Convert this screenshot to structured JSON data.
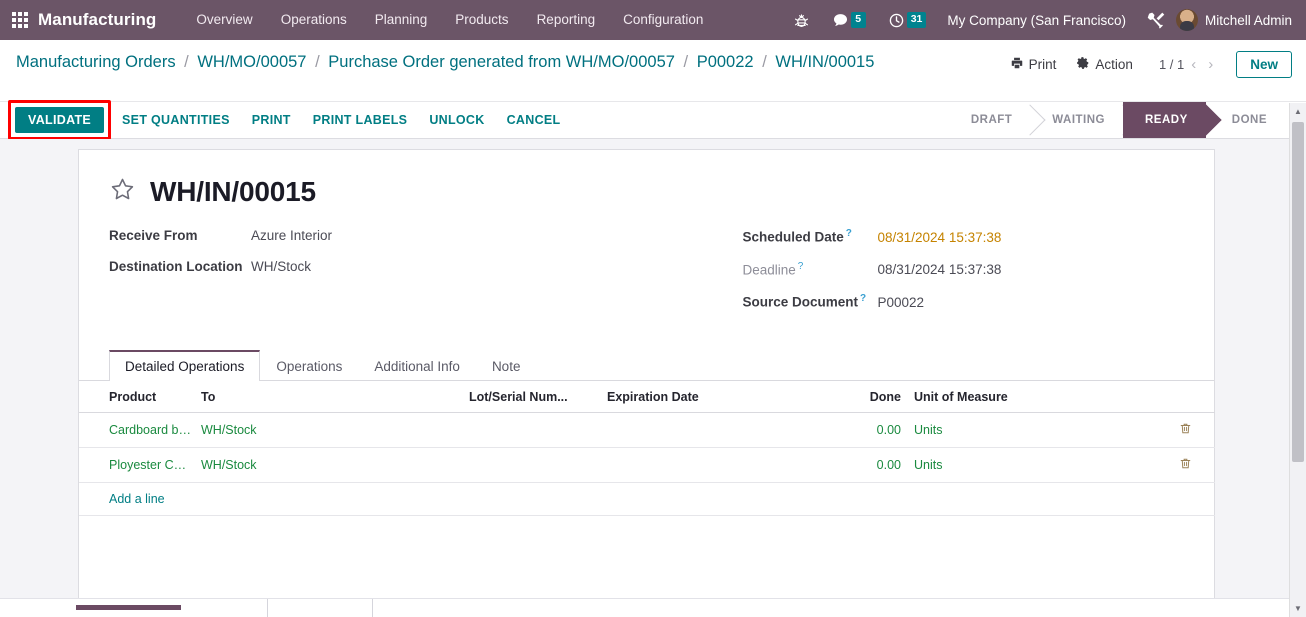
{
  "navbar": {
    "apps_icon": "apps-grid-icon",
    "brand": "Manufacturing",
    "menu": [
      {
        "label": "Overview"
      },
      {
        "label": "Operations"
      },
      {
        "label": "Planning"
      },
      {
        "label": "Products"
      },
      {
        "label": "Reporting"
      },
      {
        "label": "Configuration"
      }
    ],
    "bug_icon": "bug-icon",
    "messages_icon": "chat-bubble-icon",
    "messages_count": "5",
    "activities_icon": "clock-icon",
    "activities_count": "31",
    "company": "My Company (San Francisco)",
    "tools_icon": "wrench-screwdriver-icon",
    "user": "Mitchell Admin",
    "accent_color": "#6b5567",
    "badge_color": "#00838f"
  },
  "breadcrumb": {
    "items": [
      "Manufacturing Orders",
      "WH/MO/00057",
      "Purchase Order generated from WH/MO/00057",
      "P00022",
      "WH/IN/00015"
    ],
    "separator": "/",
    "link_color": "#00707f"
  },
  "control_panel": {
    "print_label": "Print",
    "print_icon": "printer-icon",
    "action_label": "Action",
    "action_icon": "gear-icon",
    "pager": "1 / 1",
    "prev_icon": "chevron-left-icon",
    "next_icon": "chevron-right-icon",
    "new_label": "New"
  },
  "statusbar": {
    "validate_label": "VALIDATE",
    "highlight_color": "#ff0000",
    "buttons": [
      {
        "label": "SET QUANTITIES"
      },
      {
        "label": "PRINT"
      },
      {
        "label": "PRINT LABELS"
      },
      {
        "label": "UNLOCK"
      },
      {
        "label": "CANCEL"
      }
    ],
    "stages": [
      {
        "label": "DRAFT",
        "active": false
      },
      {
        "label": "WAITING",
        "active": false
      },
      {
        "label": "READY",
        "active": true
      },
      {
        "label": "DONE",
        "active": false
      }
    ],
    "active_color": "#6b4a63",
    "validate_color": "#017e84"
  },
  "form": {
    "star_icon": "star-outline-icon",
    "title": "WH/IN/00015",
    "left_fields": [
      {
        "label": "Receive From",
        "value": "Azure Interior",
        "help": false,
        "muted": false,
        "warn": false
      },
      {
        "label": "Destination Location",
        "value": "WH/Stock",
        "help": false,
        "muted": false,
        "warn": false
      }
    ],
    "right_fields": [
      {
        "label": "Scheduled Date",
        "value": "08/31/2024 15:37:38",
        "help": true,
        "muted": false,
        "warn": true
      },
      {
        "label": "Deadline",
        "value": "08/31/2024 15:37:38",
        "help": true,
        "muted": true,
        "warn": false
      },
      {
        "label": "Source Document",
        "value": "P00022",
        "help": true,
        "muted": false,
        "warn": false
      }
    ],
    "help_marker": "?",
    "warn_color": "#c58300"
  },
  "notebook": {
    "tabs": [
      {
        "label": "Detailed Operations",
        "active": true
      },
      {
        "label": "Operations",
        "active": false
      },
      {
        "label": "Additional Info",
        "active": false
      },
      {
        "label": "Note",
        "active": false
      }
    ]
  },
  "table": {
    "columns": [
      "Product",
      "To",
      "Lot/Serial Num...",
      "Expiration Date",
      "Done",
      "Unit of Measure"
    ],
    "rows": [
      {
        "product": "Cardboard boxes",
        "to": "WH/Stock",
        "lot": "",
        "expiration": "",
        "done": "0.00",
        "uom": "Units",
        "delete_icon": "trash-icon"
      },
      {
        "product": "Ployester Covers",
        "to": "WH/Stock",
        "lot": "",
        "expiration": "",
        "done": "0.00",
        "uom": "Units",
        "delete_icon": "trash-icon"
      }
    ],
    "add_line_label": "Add a line",
    "row_color": "#1a8a3f"
  },
  "scrollbar": {
    "up_icon": "triangle-up-icon",
    "down_icon": "triangle-down-icon"
  }
}
